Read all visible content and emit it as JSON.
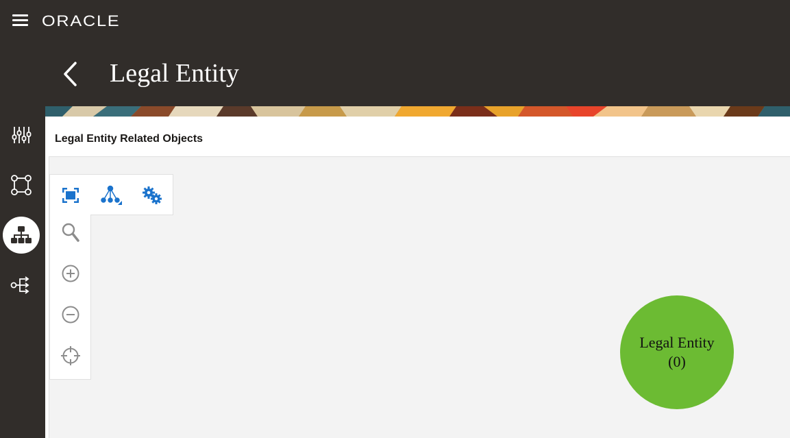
{
  "header": {
    "brand": "ORACLE",
    "page_title": "Legal Entity"
  },
  "rail": {
    "items": [
      {
        "icon": "sliders-icon"
      },
      {
        "icon": "nodes-square-icon"
      },
      {
        "icon": "hierarchy-icon",
        "active": true
      },
      {
        "icon": "flow-branch-icon"
      }
    ]
  },
  "main": {
    "section_title": "Legal Entity Related Objects",
    "toolbar": {
      "horizontal": [
        "fit-to-screen-icon",
        "layout-icon",
        "settings-gears-icon"
      ],
      "vertical": [
        "search-icon",
        "zoom-in-icon",
        "zoom-out-icon",
        "center-crosshair-icon"
      ]
    },
    "node": {
      "label": "Legal Entity",
      "count": "(0)",
      "color": "#6cbb33"
    }
  },
  "colors": {
    "header_bg": "#312d2a",
    "canvas_bg": "#f3f3f3",
    "accent_blue": "#1b73cc"
  }
}
